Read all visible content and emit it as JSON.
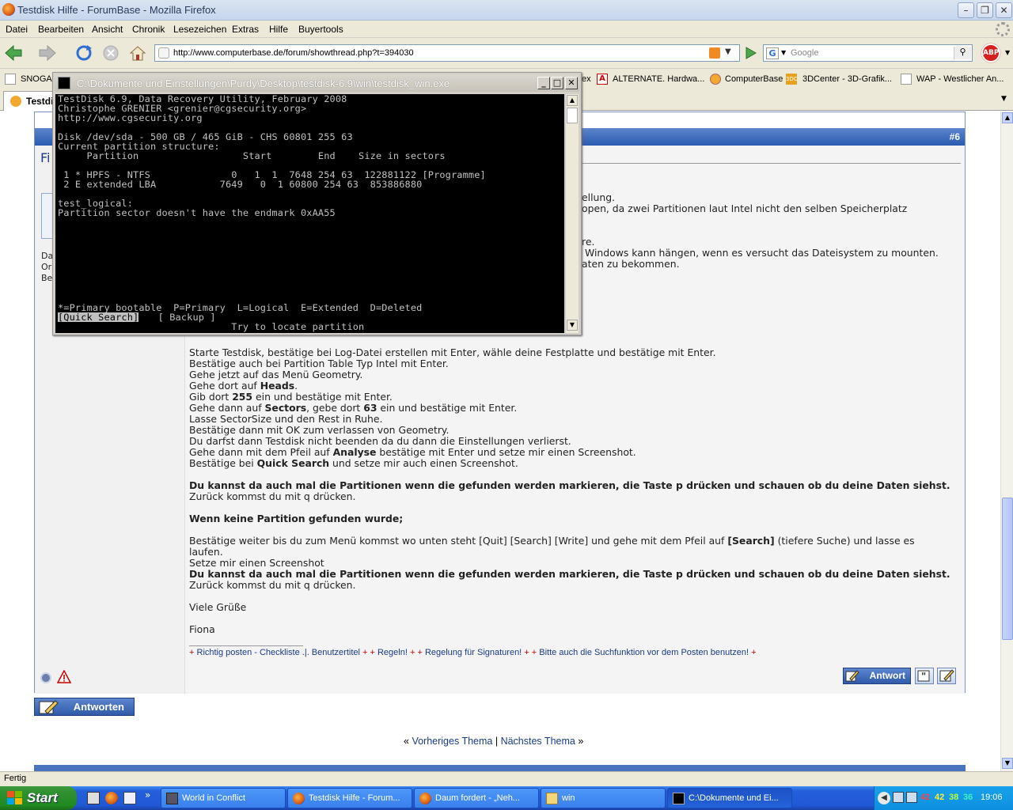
{
  "browser": {
    "title": "Testdisk Hilfe - ForumBase - Mozilla Firefox",
    "menu": [
      "Datei",
      "Bearbeiten",
      "Ansicht",
      "Chronik",
      "Lesezeichen",
      "Extras",
      "Hilfe",
      "Buyertools"
    ],
    "url": "http://www.computerbase.de/forum/showthread.php?t=394030",
    "search_placeholder": "Google",
    "bookmarks": [
      "SNOGAR",
      "ex",
      "ALTERNATE. Hardwa...",
      "ComputerBase",
      "3DCenter - 3D-Grafik...",
      "WAP - Westlicher An..."
    ],
    "tab_label": "Testdi",
    "status": "Fertig"
  },
  "post": {
    "number": "#6",
    "left_partial": [
      "Fi",
      "Da",
      "Or",
      "Be"
    ],
    "partial_lines": [
      "ellung.",
      "open, da zwei Partitionen laut Intel nicht den selben Speicherplatz",
      "re.",
      "Windows kann hängen, wenn es versucht das Dateisystem zu mounten.",
      "aten zu bekommen."
    ],
    "lines": {
      "l1": "Starte Testdisk, bestätige bei Log-Datei erstellen mit Enter, wähle deine Festplatte und bestätige mit Enter.",
      "l2": "Bestätige auch bei Partition Table Typ Intel mit Enter.",
      "l3": "Gehe jetzt auf das Menü Geometry.",
      "l4a": "Gehe dort auf ",
      "l4b": "Heads",
      "l4c": ".",
      "l5a": "Gib dort ",
      "l5b": "255",
      "l5c": " ein und bestätige mit Enter.",
      "l6a": "Gehe dann auf ",
      "l6b": "Sectors",
      "l6c": ", gebe dort ",
      "l6d": "63",
      "l6e": " ein und bestätige mit Enter.",
      "l7": "Lasse SectorSize und den Rest in Ruhe.",
      "l8": "Bestätige dann mit OK zum verlassen von Geometry.",
      "l9": "Du darfst dann Testdisk nicht beenden da du dann die Einstellungen verlierst.",
      "l10a": "Gehe dann mit dem Pfeil auf ",
      "l10b": "Analyse",
      "l10c": " bestätige mit Enter und setze mir einen Screenshot.",
      "l11a": "Bestätige bei ",
      "l11b": "Quick Search",
      "l11c": " und setze mir auch einen Screenshot.",
      "l12": "Du kannst da auch mal die Partitionen wenn die gefunden werden markieren, die Taste p drücken und schauen ob du deine Daten siehst.",
      "l13": "Zurück kommst du mit q drücken.",
      "l14": "Wenn keine Partition gefunden wurde;",
      "l15a": "Bestätige weiter bis du zum Menü kommst wo unten steht [Quit] [Search] [Write] und gehe mit dem Pfeil auf ",
      "l15b": "[Search]",
      "l15c": " (tiefere Suche) und lasse es",
      "l16": "laufen.",
      "l17": "Setze mir einen Screenshot",
      "l18": "Du kannst da auch mal die Partitionen wenn die gefunden werden markieren, die Taste p drücken und schauen ob du deine Daten siehst.",
      "l19": "Zurück kommst du mit q drücken.",
      "l20": "Viele Grüße",
      "l21": "Fiona"
    },
    "signature": {
      "s1": "Richtig posten - Checkliste .|. Benutzertitel",
      "s2": "Regeln!",
      "s3": "Regelung für Signaturen!",
      "s4": "Bitte auch die Suchfunktion vor dem Posten benutzen!"
    },
    "reply_button": "Antwort",
    "answer_button": "Antworten"
  },
  "thread_nav": {
    "prev": "Vorheriges Thema",
    "sep": "|",
    "next": "Nächstes Thema"
  },
  "console": {
    "title": "C:\\Dokumente und Einstellungen\\Purdy\\Desktop\\testdisk-6.9\\win\\testdisk_win.exe",
    "lines": [
      "TestDisk 6.9, Data Recovery Utility, February 2008",
      "Christophe GRENIER <grenier@cgsecurity.org>",
      "http://www.cgsecurity.org",
      "",
      "Disk /dev/sda - 500 GB / 465 GiB - CHS 60801 255 63",
      "Current partition structure:",
      "     Partition                  Start        End    Size in sectors",
      "",
      " 1 * HPFS - NTFS              0   1  1  7648 254 63  122881122 [Programme]",
      " 2 E extended LBA           7649   0  1 60800 254 63  853886880",
      "",
      "test_logical:",
      "Partition sector doesn't have the endmark 0xAA55"
    ],
    "legend": "*=Primary bootable  P=Primary  L=Logical  E=Extended  D=Deleted",
    "menu_selected": "[Quick Search]",
    "menu_other": "  [ Backup ]",
    "hint": "                              Try to locate partition"
  },
  "taskbar": {
    "start": "Start",
    "items": [
      "World in Conflict",
      "Testdisk Hilfe - Forum...",
      "Daum fordert - „Neh...",
      "win",
      "C:\\Dokumente und Ei..."
    ],
    "tray_numbers": [
      "42",
      "42",
      "38",
      "36"
    ],
    "clock": "19:06"
  }
}
